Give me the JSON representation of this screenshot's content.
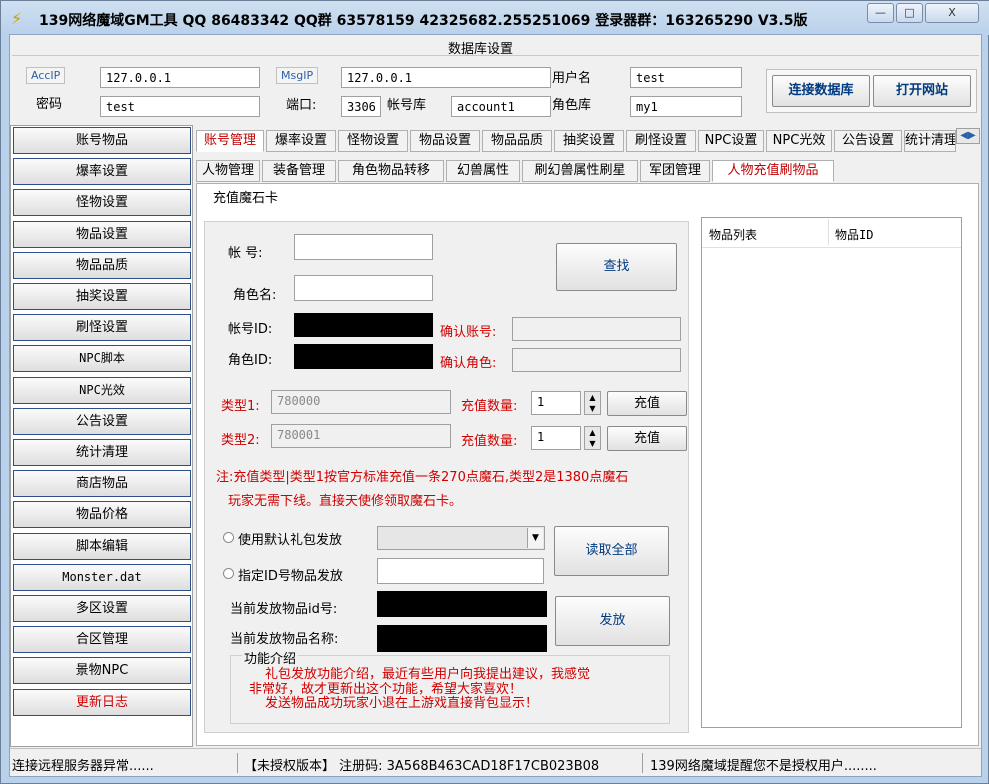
{
  "window": {
    "title": "139网络魔域GM工具 QQ 86483342 QQ群 63578159 42325682.255251069 登录器群：163265290 V3.5版",
    "controls": {
      "minimize": "—",
      "maximize": "□",
      "close": "X"
    }
  },
  "db": {
    "section_title": "数据库设置",
    "acc_ip_tag": "AccIP",
    "acc_ip": "127.0.0.1",
    "msg_ip_tag": "MsgIP",
    "msg_ip": "127.0.0.1",
    "user_label": "用户名",
    "user": "test",
    "password_label": "密码",
    "password": "test",
    "port_label": "端口:",
    "port": "3306",
    "account_db_label": "帐号库",
    "account_db": "account1",
    "role_db_label": "角色库",
    "role_db": "my1",
    "connect_button": "连接数据库",
    "open_site_button": "打开网站"
  },
  "sidebar": {
    "items": [
      {
        "label": "账号物品"
      },
      {
        "label": "爆率设置"
      },
      {
        "label": "怪物设置"
      },
      {
        "label": "物品设置"
      },
      {
        "label": "物品品质"
      },
      {
        "label": "抽奖设置"
      },
      {
        "label": "刷怪设置"
      },
      {
        "label": "NPC脚本"
      },
      {
        "label": "NPC光效"
      },
      {
        "label": "公告设置"
      },
      {
        "label": "统计清理"
      },
      {
        "label": "商店物品"
      },
      {
        "label": "物品价格"
      },
      {
        "label": "脚本编辑"
      },
      {
        "label": "Monster.dat"
      },
      {
        "label": "多区设置"
      },
      {
        "label": "合区管理"
      },
      {
        "label": "景物NPC"
      },
      {
        "label": "更新日志"
      }
    ]
  },
  "tabs_top": [
    "账号管理",
    "爆率设置",
    "怪物设置",
    "物品设置",
    "物品品质",
    "抽奖设置",
    "刷怪设置",
    "NPC设置",
    "NPC光效",
    "公告设置",
    "统计清理"
  ],
  "tabs_sub": [
    "人物管理",
    "装备管理",
    "角色物品转移",
    "幻兽属性",
    "刷幻兽属性刷星",
    "军团管理",
    "人物充值刷物品"
  ],
  "recharge": {
    "group_title": "充值魔石卡",
    "account_label": "帐   号:",
    "role_label": "角色名:",
    "account_id_label": "帐号ID:",
    "role_id_label": "角色ID:",
    "confirm_account_label": "确认账号:",
    "confirm_role_label": "确认角色:",
    "search_button": "查找",
    "type1_label": "类型1:",
    "type1_value": "780000",
    "type2_label": "类型2:",
    "type2_value": "780001",
    "qty_label": "充值数量:",
    "qty1": "1",
    "qty2": "1",
    "recharge_button": "充值",
    "note_line1": "注:充值类型|类型1按官方标准充值一条270点魔石,类型2是1380点魔石",
    "note_line2": "玩家无需下线。直接天使修领取魔石卡。",
    "radio_default": "使用默认礼包发放",
    "radio_by_id": "指定ID号物品发放",
    "read_all_button": "读取全部",
    "current_id_label": "当前发放物品id号:",
    "current_name_label": "当前发放物品名称:",
    "send_button": "发放",
    "intro_title": "功能介绍",
    "intro_line1": "礼包发放功能介绍，最近有些用户向我提出建议，我感觉",
    "intro_line2": "非常好，故才更新出这个功能，希望大家喜欢！",
    "intro_line3": "发送物品成功玩家小退在上游戏直接背包显示！"
  },
  "item_list": {
    "columns": [
      "物品列表",
      "物品ID"
    ]
  },
  "status": {
    "connection": "连接远程服务器异常......",
    "license": "【未授权版本】 注册码: 3A568B463CAD18F17CB023B08",
    "warning": "139网络魔域提醒您不是授权用户........"
  },
  "colors": {
    "accent_red": "#d00000",
    "sidebar_border": "#2d4f8a",
    "title_bg": "#b9d1ea"
  }
}
